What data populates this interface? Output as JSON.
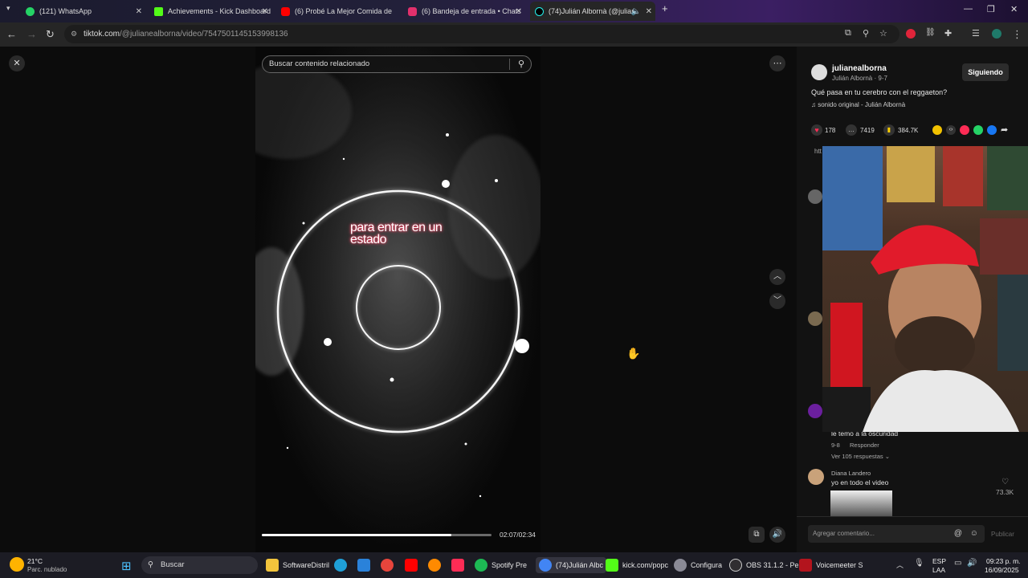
{
  "browser": {
    "tabs": [
      {
        "title": "(121) WhatsApp",
        "color": "#25D366"
      },
      {
        "title": "Achievements - Kick Dashboard",
        "color": "#53FC18"
      },
      {
        "title": "(6) Probé La Mejor Comida de",
        "color": "#FF0000"
      },
      {
        "title": "(6) Bandeja de entrada • Chats",
        "color": "#E1306C"
      },
      {
        "title": "(74)Julián Albornà (@julian",
        "color": "#111111"
      }
    ],
    "url_host": "tiktok.com",
    "url_path": "/@julianealborna/video/7547501145153998136"
  },
  "video": {
    "search_placeholder": "Buscar contenido relacionado",
    "caption_line1": "para entrar en un",
    "caption_line2": "estado",
    "time": "02:07/02:34",
    "progress": 0.825
  },
  "post": {
    "username": "julianealborna",
    "display": "Julián Albornà · 9-7",
    "follow_label": "Siguiendo",
    "description": "Qué pasa en tu cerebro con el reggaeton?",
    "sound": "sonido original - Julián Albornà",
    "likes": "178",
    "comments": "7419",
    "saves": "384.7K",
    "tooltip": "htt"
  },
  "comments": [
    {
      "text": "le temo a la oscuridad",
      "date": "9-8",
      "reply": "Responder",
      "replies": "Ver 105 respuestas"
    },
    {
      "user": "Diana Landero",
      "text": "yo en todo el video",
      "likes": "73.3K"
    }
  ],
  "comment_input": {
    "placeholder": "Agregar comentario...",
    "post": "Publicar"
  },
  "taskbar": {
    "weather_temp": "21°C",
    "weather_desc": "Parc. nublado",
    "search": "Buscar",
    "apps": [
      {
        "label": "SoftwareDistril"
      },
      {
        "label": "Spotify Pre"
      },
      {
        "label": "(74)Julián Albc"
      },
      {
        "label": "kick.com/popc"
      },
      {
        "label": "Configura"
      },
      {
        "label": "OBS 31.1.2 - Pe"
      },
      {
        "label": "Voicemeeter S"
      }
    ],
    "lang1": "ESP",
    "lang2": "LAA",
    "clock_time": "09:23 p. m.",
    "clock_date": "16/09/2025"
  }
}
